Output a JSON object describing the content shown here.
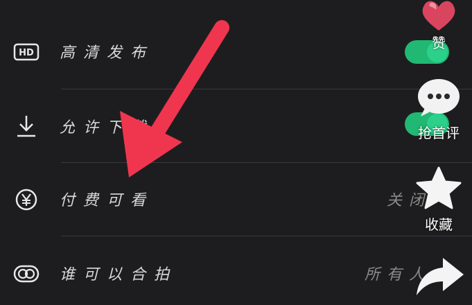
{
  "settings": {
    "rows": [
      {
        "label": "高清发布",
        "icon": "hd-icon"
      },
      {
        "label": "允许下载",
        "icon": "download-icon"
      },
      {
        "label": "付费可看",
        "icon": "yen-icon",
        "value": "关闭"
      },
      {
        "label": "谁可以合拍",
        "icon": "duet-icon",
        "value": "所有人"
      }
    ]
  },
  "overlay": {
    "like_label": "赞",
    "comment_label": "抢首评",
    "collect_label": "收藏"
  },
  "colors": {
    "toggle_on": "#21b873",
    "arrow": "#f0364f"
  }
}
